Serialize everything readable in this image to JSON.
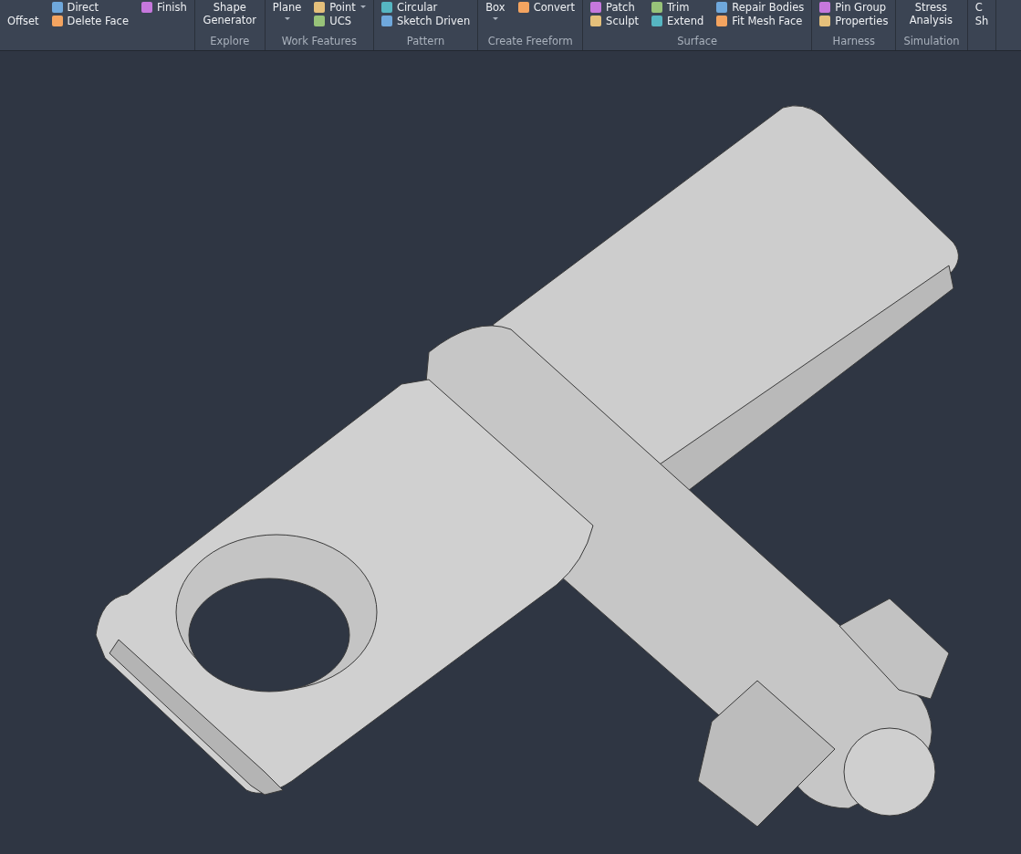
{
  "ribbon": {
    "panels": [
      {
        "columns": [
          {
            "tools": [
              {
                "label": "Offset",
                "kind": "plain"
              }
            ]
          },
          {
            "tools": [
              {
                "label": "Direct",
                "kind": "small"
              },
              {
                "label": "Delete Face",
                "kind": "small"
              }
            ]
          },
          {
            "tools": [
              {
                "label": "Finish",
                "kind": "small"
              }
            ]
          }
        ]
      },
      {
        "label": "Explore",
        "columns": [
          {
            "tools": [
              {
                "label": "Shape Generator",
                "kind": "large"
              }
            ]
          }
        ]
      },
      {
        "label": "Work Features",
        "columns": [
          {
            "tools": [
              {
                "label": "Plane",
                "kind": "large",
                "dropdown": true
              }
            ]
          },
          {
            "tools": [
              {
                "label": "Point",
                "kind": "small",
                "dropdown": true
              },
              {
                "label": "UCS",
                "kind": "small"
              }
            ]
          }
        ]
      },
      {
        "label": "Pattern",
        "columns": [
          {
            "tools": [
              {
                "label": "Circular",
                "kind": "small"
              },
              {
                "label": "Sketch Driven",
                "kind": "small"
              }
            ]
          }
        ]
      },
      {
        "label": "Create Freeform",
        "columns": [
          {
            "tools": [
              {
                "label": "Box",
                "kind": "large",
                "dropdown": true
              }
            ]
          },
          {
            "tools": [
              {
                "label": "Convert",
                "kind": "small"
              }
            ]
          }
        ]
      },
      {
        "label": "Surface",
        "columns": [
          {
            "tools": [
              {
                "label": "Patch",
                "kind": "small"
              },
              {
                "label": "Sculpt",
                "kind": "small"
              }
            ]
          },
          {
            "tools": [
              {
                "label": "Trim",
                "kind": "small"
              },
              {
                "label": "Extend",
                "kind": "small"
              }
            ]
          },
          {
            "tools": [
              {
                "label": "Repair Bodies",
                "kind": "small"
              },
              {
                "label": "Fit Mesh Face",
                "kind": "small"
              }
            ]
          }
        ]
      },
      {
        "label": "Harness",
        "columns": [
          {
            "tools": [
              {
                "label": "Pin Group",
                "kind": "small"
              },
              {
                "label": "Properties",
                "kind": "small"
              }
            ]
          }
        ]
      },
      {
        "label": "Simulation",
        "columns": [
          {
            "tools": [
              {
                "label": "Stress Analysis",
                "kind": "large"
              }
            ]
          }
        ]
      },
      {
        "columns": [
          {
            "tools": [
              {
                "label": "C",
                "kind": "partial"
              },
              {
                "label": "Sh",
                "kind": "partial"
              }
            ]
          }
        ]
      }
    ]
  }
}
